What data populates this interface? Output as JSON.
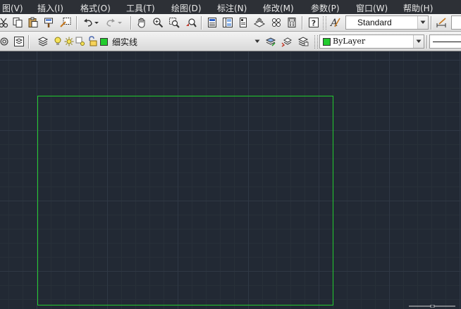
{
  "menubar": {
    "items": [
      "图(V)",
      "插入(I)",
      "格式(O)",
      "工具(T)",
      "绘图(D)",
      "标注(N)",
      "修改(M)",
      "参数(P)",
      "窗口(W)",
      "帮助(H)"
    ]
  },
  "toolbar": {
    "text_style_combo": {
      "value": "Standard"
    }
  },
  "layers_toolbar": {
    "layer_combo": {
      "value": "细实线",
      "swatch_color": "#22cc2e"
    },
    "color_combo": {
      "value": "ByLayer",
      "swatch_color": "#22cc2e"
    }
  },
  "drawing": {
    "rectangle_color": "#22cc2e",
    "background_color": "#222934"
  }
}
